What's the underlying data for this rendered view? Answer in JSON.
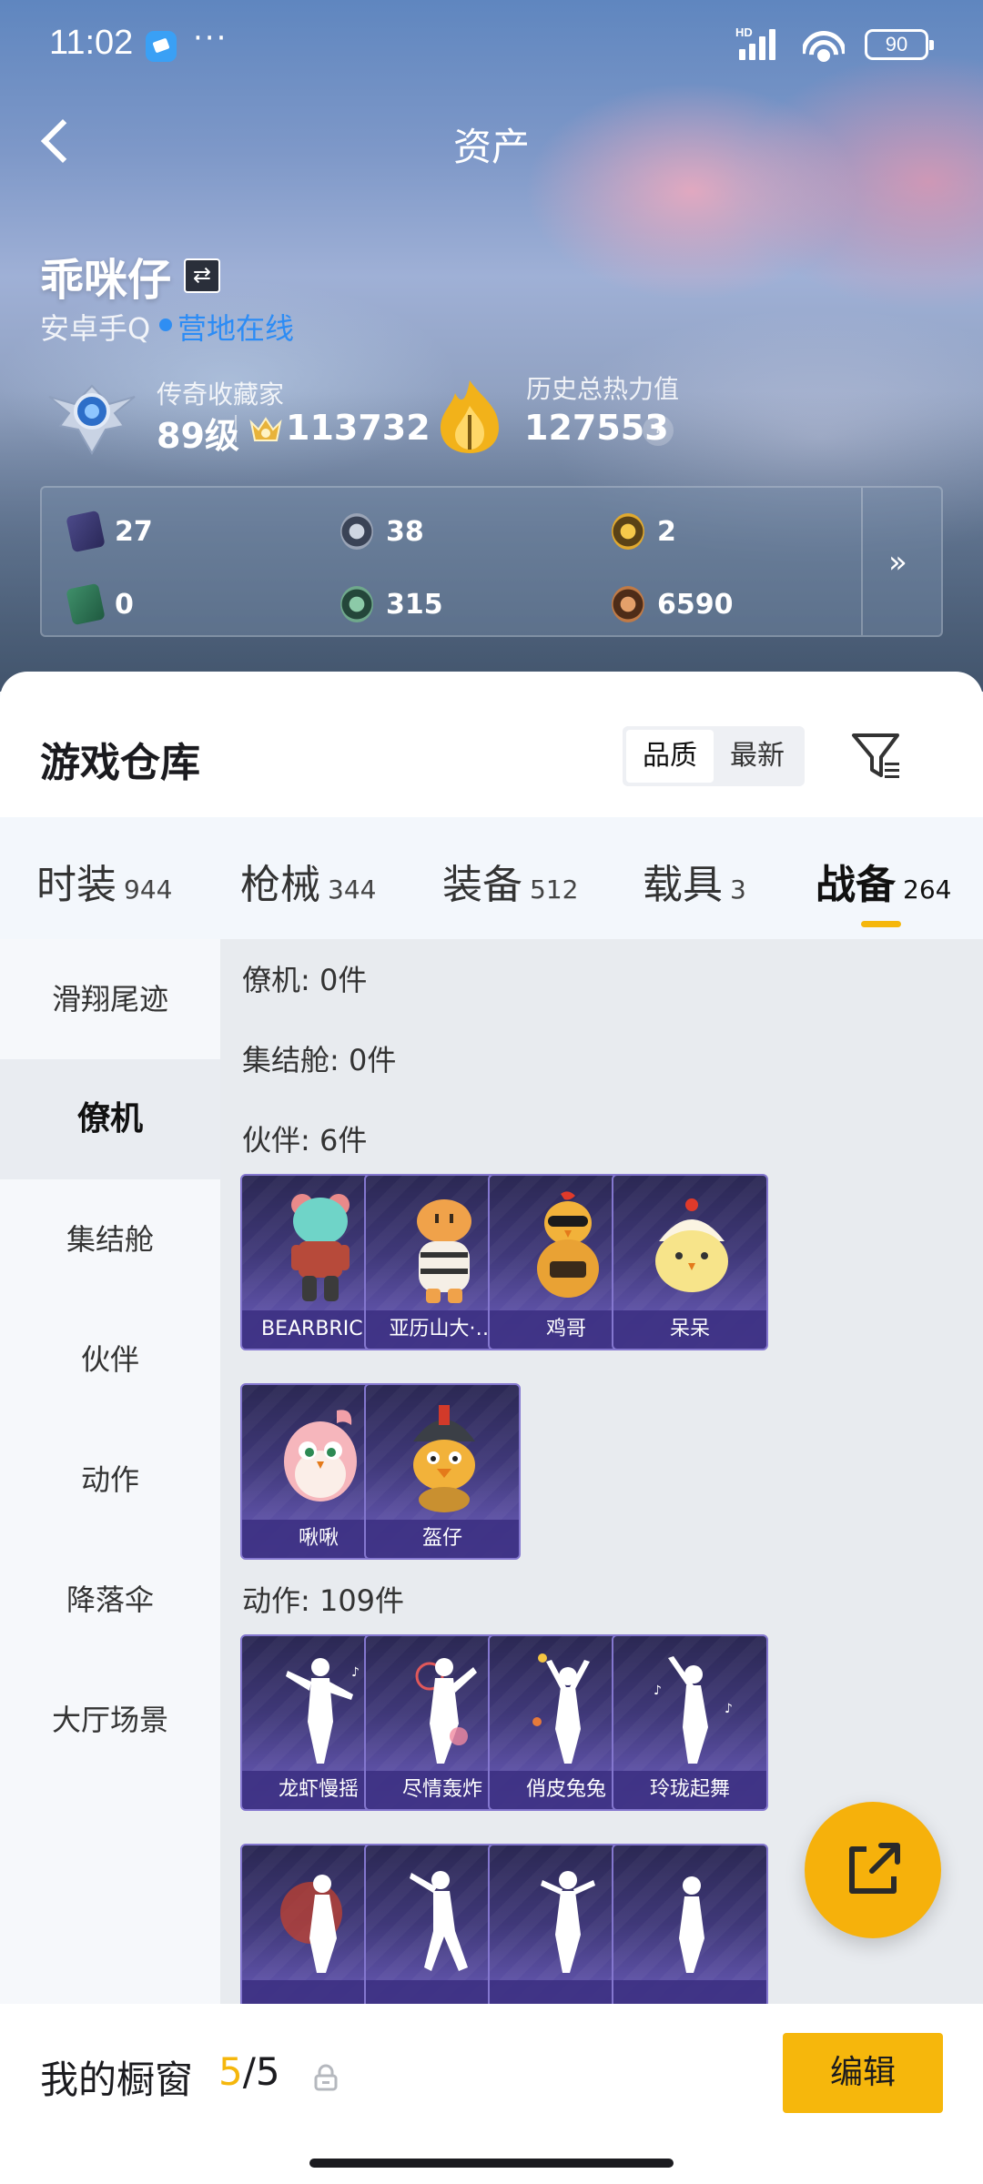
{
  "status": {
    "time": "11:02",
    "dots": "···",
    "net": "HD",
    "battery": "90"
  },
  "nav": {
    "title": "资产"
  },
  "profile": {
    "name": "乖咪仔",
    "platform": "安卓手Q",
    "online": "营地在线",
    "rank_title": "传奇收藏家",
    "level": "89级",
    "coins": "113732",
    "heat_title": "历史总热力值",
    "heat_value": "127553",
    "help": "?"
  },
  "currencies": {
    "c1": "27",
    "c2": "38",
    "c3": "2",
    "c4": "0",
    "c5": "315",
    "c6": "6590",
    "more": "»"
  },
  "warehouse": {
    "title": "游戏仓库",
    "sort_quality": "品质",
    "sort_new": "最新"
  },
  "tabs": [
    {
      "label": "时装",
      "count": "944"
    },
    {
      "label": "枪械",
      "count": "344"
    },
    {
      "label": "装备",
      "count": "512"
    },
    {
      "label": "载具",
      "count": "3"
    },
    {
      "label": "战备",
      "count": "264"
    }
  ],
  "sidebar": [
    {
      "label": "滑翔尾迹"
    },
    {
      "label": "僚机"
    },
    {
      "label": "集结舱"
    },
    {
      "label": "伙伴"
    },
    {
      "label": "动作"
    },
    {
      "label": "降落伞"
    },
    {
      "label": "大厅场景"
    }
  ],
  "sections": {
    "wingman": "僚机: 0件",
    "pod": "集结舱: 0件",
    "partner": "伙伴: 6件",
    "emote": "动作: 109件"
  },
  "partners": [
    "BEARBRICK",
    "亚历山大·…",
    "鸡哥",
    "呆呆",
    "啾啾",
    "盔仔"
  ],
  "emotes": [
    "龙虾慢摇",
    "尽情轰炸",
    "俏皮兔兔",
    "玲珑起舞",
    "",
    "",
    "",
    ""
  ],
  "showcase": {
    "title": "我的橱窗",
    "current": "5",
    "total": "/5",
    "edit": "编辑"
  },
  "colors": {
    "accent": "#f5b70c",
    "link": "#2c8cf5",
    "card": "#3f3878"
  }
}
